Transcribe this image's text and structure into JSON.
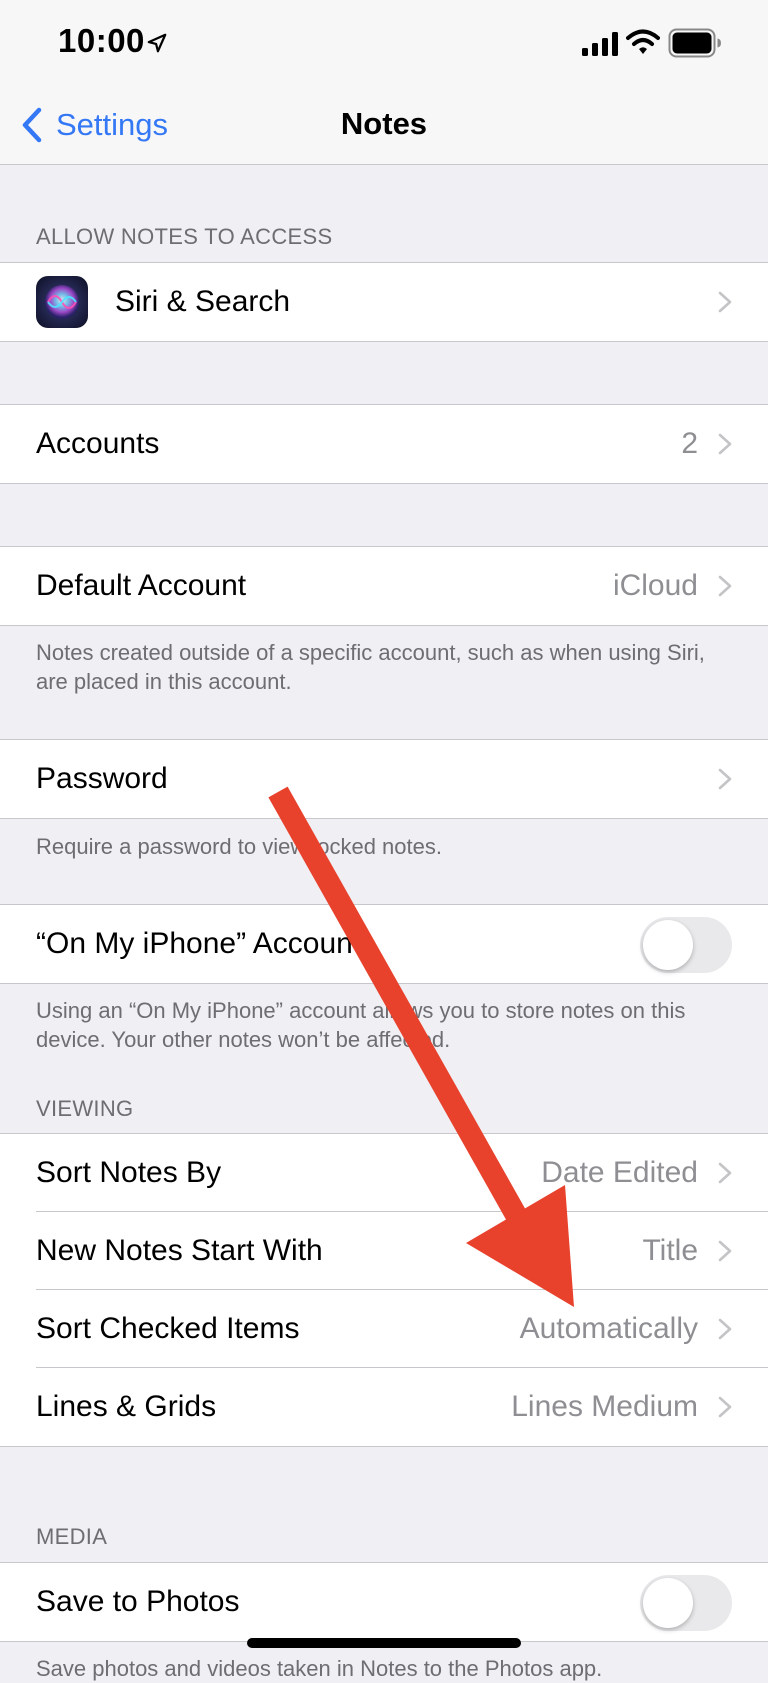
{
  "status_bar": {
    "time": "10:00"
  },
  "nav": {
    "back_label": "Settings",
    "title": "Notes"
  },
  "sections": {
    "allow": {
      "header": "ALLOW NOTES TO ACCESS",
      "siri_label": "Siri & Search"
    },
    "accounts": {
      "label": "Accounts",
      "value": "2"
    },
    "default_account": {
      "label": "Default Account",
      "value": "iCloud",
      "footer": "Notes created outside of a specific account, such as when using Siri, are placed in this account."
    },
    "password": {
      "label": "Password",
      "footer": "Require a password to view locked notes."
    },
    "on_my_iphone": {
      "label": "“On My iPhone” Account",
      "toggle_on": false,
      "footer": "Using an “On My iPhone” account allows you to store notes on this device. Your other notes won’t be affected."
    },
    "viewing": {
      "header": "VIEWING",
      "rows": [
        {
          "label": "Sort Notes By",
          "value": "Date Edited"
        },
        {
          "label": "New Notes Start With",
          "value": "Title"
        },
        {
          "label": "Sort Checked Items",
          "value": "Automatically"
        },
        {
          "label": "Lines & Grids",
          "value": "Lines Medium"
        }
      ]
    },
    "media": {
      "header": "MEDIA",
      "save_label": "Save to Photos",
      "toggle_on": false,
      "footer": "Save photos and videos taken in Notes to the Photos app."
    }
  },
  "colors": {
    "accent": "#3478f6",
    "annotation_arrow": "#e8412c"
  },
  "icons": [
    "location-arrow-icon",
    "cellular-signal-icon",
    "wifi-icon",
    "battery-icon",
    "back-chevron-icon",
    "siri-icon",
    "chevron-right-icon"
  ]
}
